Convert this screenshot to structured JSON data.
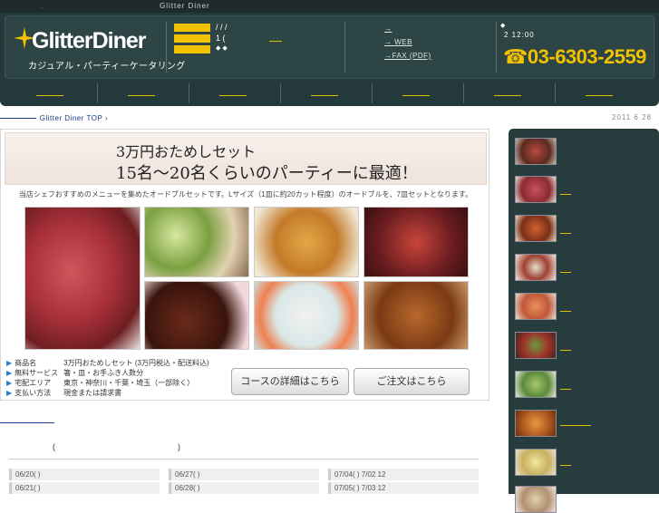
{
  "topbar": {
    "site_name": "Glitter Diner",
    "dot": "."
  },
  "header": {
    "logo": "GlitterDiner",
    "logo_sub": "カジュアル・パーティーケータリング",
    "nav_slashes": "/  /  /",
    "nav_paren": "1  (",
    "nav_diamonds": "◆     ◆",
    "contact_items": [
      "→",
      "→  WEB",
      "→FAX  (PDF)"
    ],
    "hours_diamond": "◆",
    "hours": "2   12:00",
    "tel": "☎03-6303-2559"
  },
  "breadcrumb": {
    "home_link": "Glitter Diner TOP",
    "arrow": "›"
  },
  "date": "2011 6 28",
  "banner": {
    "title1": "3万円おためしセット",
    "title2": "15名～20名くらいのパーティーに最適！",
    "description": "当店シェフおすすめのメニューを集めたオードブルセットです。Lサイズ（1皿に約20カット程度）のオードブルを、7皿セットとなります。",
    "info": [
      {
        "label": "商品名",
        "value": "3万円おためしセット (3万円税込・配送料込)"
      },
      {
        "label": "無料サービス",
        "value": "箸・皿・お手ふき人数分"
      },
      {
        "label": "宅配エリア",
        "value": "東京・神奈川・千葉・埼玉（一部除く）"
      },
      {
        "label": "支払い方法",
        "value": "現金または請求書"
      }
    ],
    "detail_button": "コースの詳細はこちら",
    "order_button": "ご注文はこちら"
  },
  "calendar_heading": {
    "open": "(",
    "close": ")"
  },
  "calendar": [
    [
      "06/20( )",
      "06/27( )",
      "07/04( )  7/02 12"
    ],
    [
      "06/21( )",
      "06/28( )",
      "07/05( )  7/03 12"
    ]
  ],
  "sidebar_thumb_count": 9,
  "colors": {
    "header_bg": "#23393a",
    "accent_yellow": "#f2c200",
    "sidebar_bg": "#263c3d"
  }
}
